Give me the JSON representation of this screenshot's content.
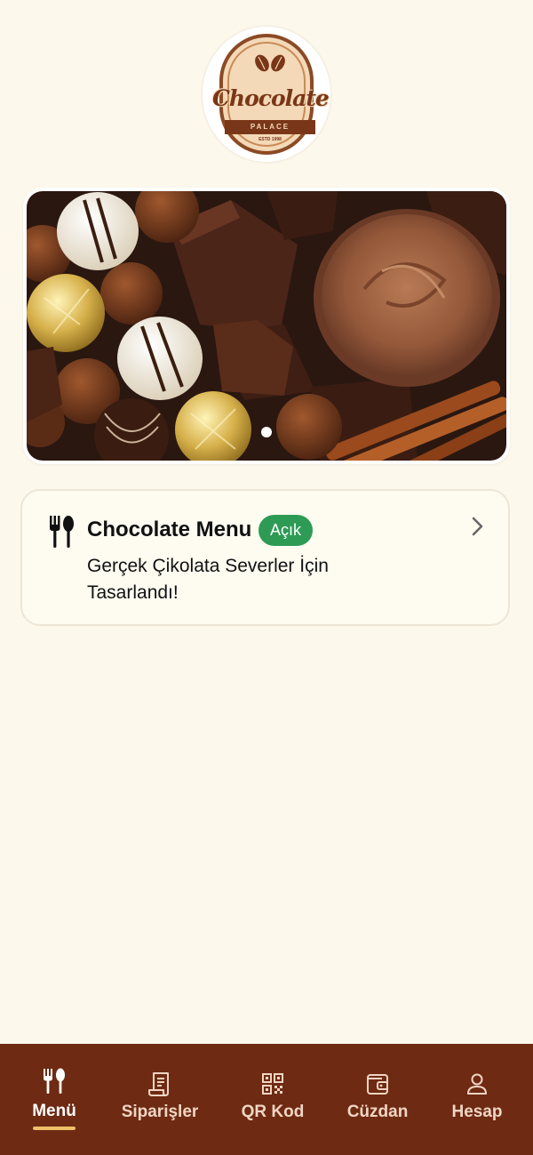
{
  "logo": {
    "script_text": "Chocolate",
    "sub_text": "PALACE",
    "est_text": "ESTD 1998"
  },
  "banner": {
    "image_icon": "chocolate-assortment-photo",
    "active_slide": 1,
    "slide_count": 1
  },
  "menu_card": {
    "icon": "fork-spoon-icon",
    "title": "Chocolate Menu",
    "status": "Açık",
    "description": "Gerçek Çikolata Severler İçin Tasarlandı!",
    "chevron_icon": "chevron-right-icon"
  },
  "bottom_nav": {
    "items": [
      {
        "label": "Menü",
        "icon": "fork-spoon-icon",
        "active": true
      },
      {
        "label": "Siparişler",
        "icon": "receipt-icon",
        "active": false
      },
      {
        "label": "QR Kod",
        "icon": "qr-code-icon",
        "active": false
      },
      {
        "label": "Cüzdan",
        "icon": "wallet-icon",
        "active": false
      },
      {
        "label": "Hesap",
        "icon": "person-icon",
        "active": false
      }
    ]
  },
  "colors": {
    "background": "#fdf8ec",
    "nav_background": "#6e2a12",
    "status_green": "#2e9b55",
    "nav_active_underline": "#f0c06a"
  }
}
